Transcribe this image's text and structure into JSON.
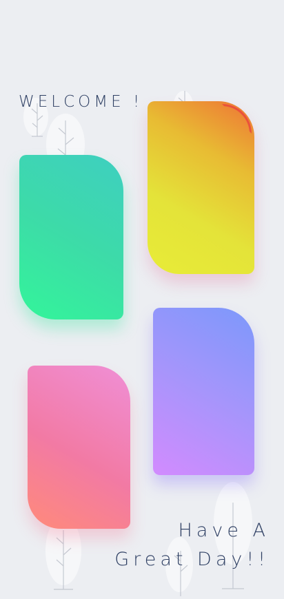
{
  "welcome_text": "WELCOME !",
  "greeting": {
    "line1": "Have A",
    "line2": "Great Day!!"
  },
  "cards": [
    {
      "name": "green",
      "colors": [
        "#33f59a",
        "#3ecfc0"
      ]
    },
    {
      "name": "yellow",
      "colors": [
        "#e8ec37",
        "#ee7436"
      ]
    },
    {
      "name": "purple",
      "colors": [
        "#d28bfe",
        "#7c98fb"
      ]
    },
    {
      "name": "pink",
      "colors": [
        "#ff8a7a",
        "#f08fd6"
      ]
    }
  ],
  "text_color": "#2e3f63",
  "background_color": "#eceef2"
}
